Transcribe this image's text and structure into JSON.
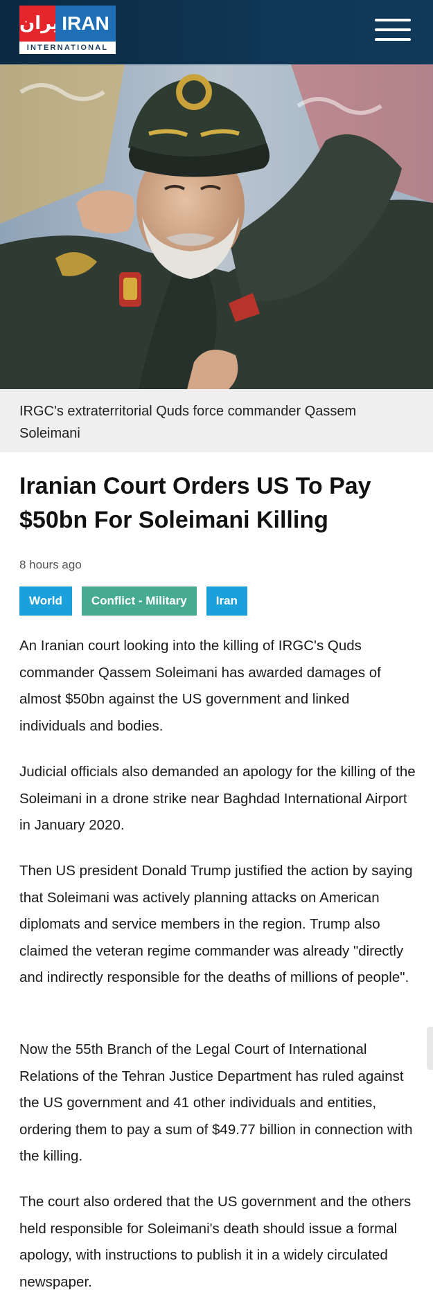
{
  "header": {
    "logo": {
      "farsi_text": "ایران",
      "brand_text": "IRAN",
      "sub_text": "INTERNATIONAL"
    },
    "menu_icon": "hamburger-menu-icon"
  },
  "hero": {
    "caption": "IRGC's extraterritorial Quds force commander Qassem Soleimani"
  },
  "article": {
    "headline": "Iranian Court Orders US To Pay $50bn For Soleimani Killing",
    "timestamp": "8 hours ago",
    "tags": [
      "World",
      "Conflict - Military",
      "Iran"
    ],
    "paragraphs": [
      "An Iranian court looking into the killing of IRGC's Quds commander Qassem Soleimani has awarded damages of almost $50bn against the US government and linked individuals and bodies.",
      "Judicial officials also demanded an apology for the killing of the Soleimani in a drone strike near Baghdad International Airport in January 2020.",
      "Then US president Donald Trump justified the action by saying that Soleimani was actively planning attacks on American diplomats and service members in the region. Trump also claimed the veteran regime commander was already \"directly and indirectly responsible for the deaths of millions of people\".",
      "Now the 55th Branch of the Legal Court of International Relations of the Tehran Justice Department has ruled against the US government and 41 other individuals and entities, ordering them to pay a sum of $49.77 billion in connection with the killing.",
      "The court also ordered that the US government and the others held responsible for Soleimani's death should issue a formal apology, with instructions to publish it in a widely circulated newspaper."
    ]
  },
  "colors": {
    "header_bg": "#0f3553",
    "logo_red": "#e4252b",
    "logo_blue": "#1f6fb6",
    "tag_blue": "#1ca0db",
    "tag_green": "#47ab91",
    "caption_bg": "#efefef"
  }
}
